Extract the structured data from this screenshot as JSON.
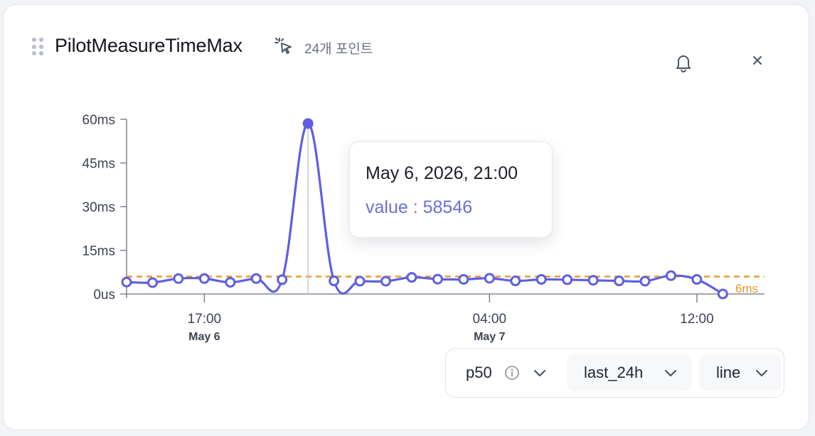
{
  "header": {
    "title": "PilotMeasureTimeMax",
    "points_label": "24개 포인트"
  },
  "icons": {
    "drag": "drag-handle-icon",
    "cursor": "cursor-click-icon",
    "bell": "bell-icon",
    "close": "close-icon",
    "info": "info-icon",
    "chevron": "chevron-down-icon"
  },
  "colors": {
    "series": "#5f5fe0",
    "threshold": "#e8962e",
    "hover_line": "#c7cad1",
    "tooltip_value": "#6b6de0"
  },
  "tooltip": {
    "date": "May 6, 2026, 21:00",
    "value_text": "value : 58546"
  },
  "controls": {
    "stat": "p50",
    "range": "last_24h",
    "chart_type": "line"
  },
  "chart_data": {
    "type": "line",
    "x_unit": "hour",
    "x": [
      "2026-05-06 14:00",
      "2026-05-06 15:00",
      "2026-05-06 16:00",
      "2026-05-06 17:00",
      "2026-05-06 18:00",
      "2026-05-06 19:00",
      "2026-05-06 20:00",
      "2026-05-06 21:00",
      "2026-05-06 22:00",
      "2026-05-06 23:00",
      "2026-05-07 00:00",
      "2026-05-07 01:00",
      "2026-05-07 02:00",
      "2026-05-07 03:00",
      "2026-05-07 04:00",
      "2026-05-07 05:00",
      "2026-05-07 06:00",
      "2026-05-07 07:00",
      "2026-05-07 08:00",
      "2026-05-07 09:00",
      "2026-05-07 10:00",
      "2026-05-07 11:00",
      "2026-05-07 12:00",
      "2026-05-07 13:00"
    ],
    "series": [
      {
        "name": "value",
        "values": [
          4100,
          3900,
          5300,
          5300,
          4000,
          5300,
          4900,
          5300,
          4500,
          4400,
          4400,
          5700,
          5100,
          5000,
          5400,
          4500,
          5000,
          4900,
          4700,
          4500,
          4400,
          6300,
          5000,
          1
        ]
      }
    ],
    "point_count": 24,
    "highlighted_point": {
      "x": "2026-05-06 21:00",
      "y": 58546
    },
    "threshold": {
      "value": 6000,
      "label": "6ms"
    },
    "y_ticks": [
      {
        "value": 0,
        "label": "0us"
      },
      {
        "value": 15000,
        "label": "15ms"
      },
      {
        "value": 30000,
        "label": "30ms"
      },
      {
        "value": 45000,
        "label": "45ms"
      },
      {
        "value": 60000,
        "label": "60ms"
      }
    ],
    "x_ticks": [
      {
        "x": "2026-05-06 17:00",
        "label": "17:00",
        "sublabel": "May 6"
      },
      {
        "x": "2026-05-07 04:00",
        "label": "04:00",
        "sublabel": "May 7"
      },
      {
        "x": "2026-05-07 12:00",
        "label": "12:00",
        "sublabel": ""
      }
    ],
    "ylim": [
      0,
      60000
    ],
    "grid": false
  }
}
